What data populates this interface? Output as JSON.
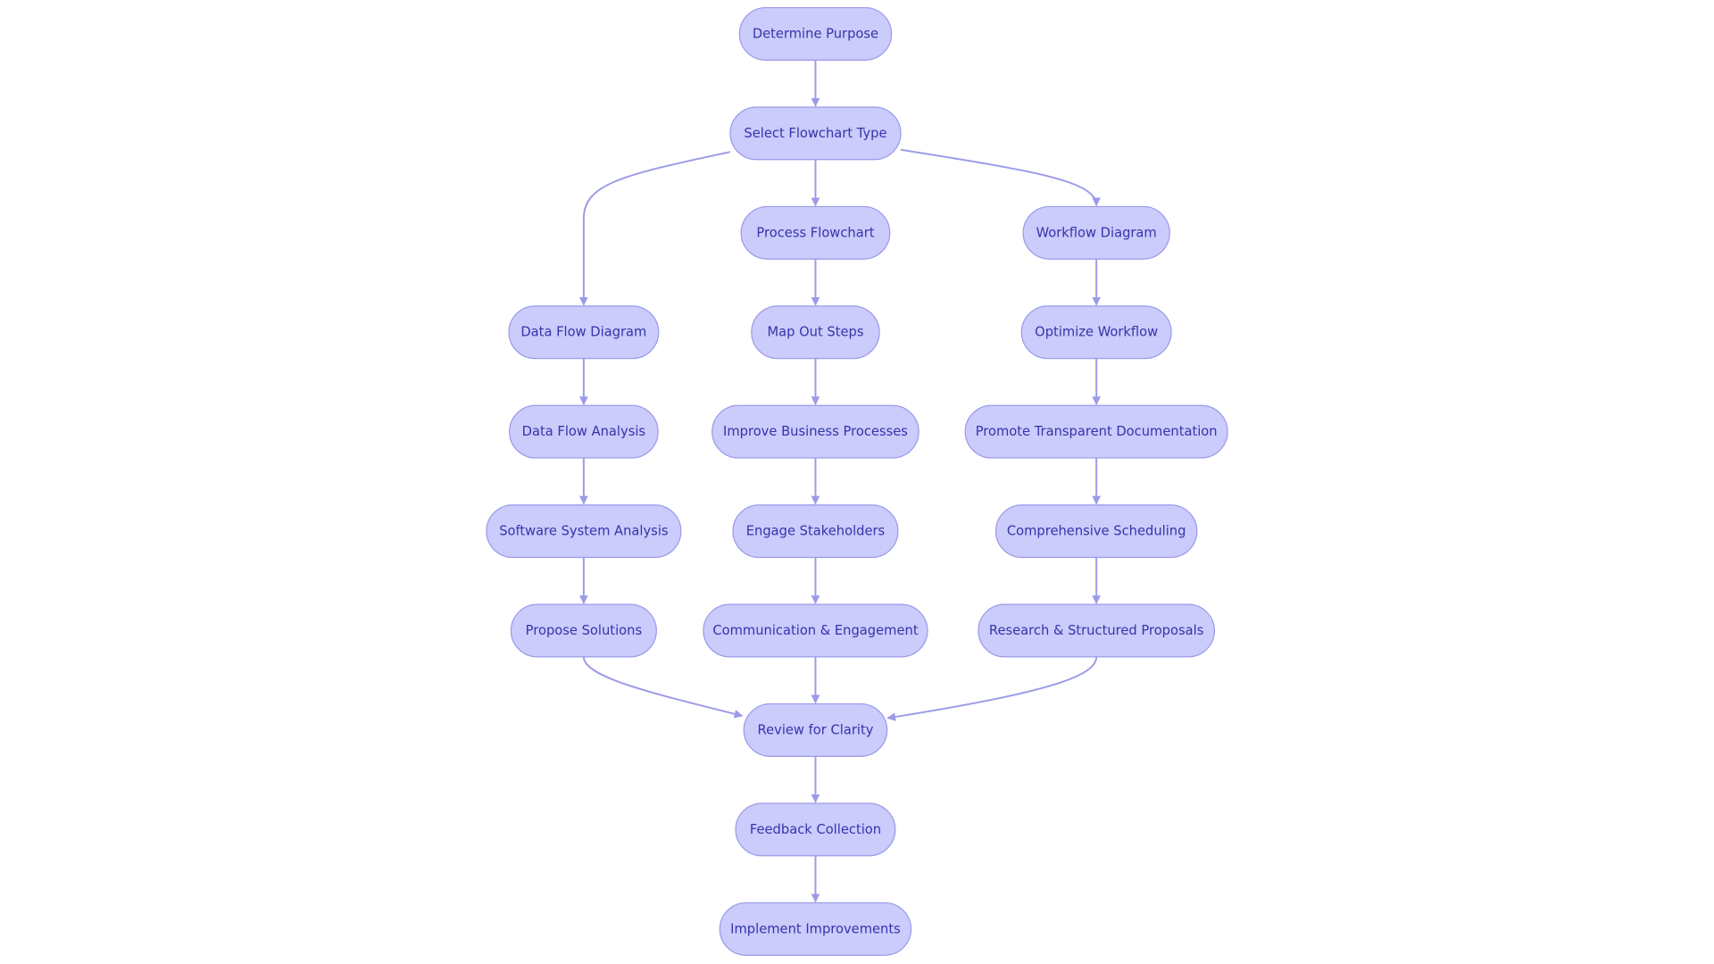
{
  "diagram": {
    "type": "flowchart",
    "colors": {
      "node_fill": "#cbcbfc",
      "node_stroke": "#9a9ae8",
      "text": "#3434aa",
      "edge": "#9b9be8"
    },
    "nodes": [
      {
        "id": "A",
        "label": "Determine Purpose"
      },
      {
        "id": "B",
        "label": "Select Flowchart Type"
      },
      {
        "id": "C",
        "label": "Process Flowchart"
      },
      {
        "id": "D",
        "label": "Workflow Diagram"
      },
      {
        "id": "E",
        "label": "Data Flow Diagram"
      },
      {
        "id": "F",
        "label": "Map Out Steps"
      },
      {
        "id": "G",
        "label": "Optimize Workflow"
      },
      {
        "id": "H",
        "label": "Data Flow Analysis"
      },
      {
        "id": "I",
        "label": "Improve Business Processes"
      },
      {
        "id": "J",
        "label": "Promote Transparent Documentation"
      },
      {
        "id": "K",
        "label": "Software System Analysis"
      },
      {
        "id": "L",
        "label": "Engage Stakeholders"
      },
      {
        "id": "M",
        "label": "Comprehensive Scheduling"
      },
      {
        "id": "N",
        "label": "Propose Solutions"
      },
      {
        "id": "O",
        "label": "Communication & Engagement"
      },
      {
        "id": "P",
        "label": "Research & Structured Proposals"
      },
      {
        "id": "Q",
        "label": "Review for Clarity"
      },
      {
        "id": "R",
        "label": "Feedback Collection"
      },
      {
        "id": "S",
        "label": "Implement Improvements"
      }
    ],
    "edges": [
      {
        "from": "A",
        "to": "B"
      },
      {
        "from": "B",
        "to": "E"
      },
      {
        "from": "B",
        "to": "C"
      },
      {
        "from": "B",
        "to": "D"
      },
      {
        "from": "C",
        "to": "F"
      },
      {
        "from": "D",
        "to": "G"
      },
      {
        "from": "E",
        "to": "H"
      },
      {
        "from": "F",
        "to": "I"
      },
      {
        "from": "G",
        "to": "J"
      },
      {
        "from": "H",
        "to": "K"
      },
      {
        "from": "I",
        "to": "L"
      },
      {
        "from": "J",
        "to": "M"
      },
      {
        "from": "K",
        "to": "N"
      },
      {
        "from": "L",
        "to": "O"
      },
      {
        "from": "M",
        "to": "P"
      },
      {
        "from": "N",
        "to": "Q"
      },
      {
        "from": "O",
        "to": "Q"
      },
      {
        "from": "P",
        "to": "Q"
      },
      {
        "from": "Q",
        "to": "R"
      },
      {
        "from": "R",
        "to": "S"
      }
    ]
  }
}
